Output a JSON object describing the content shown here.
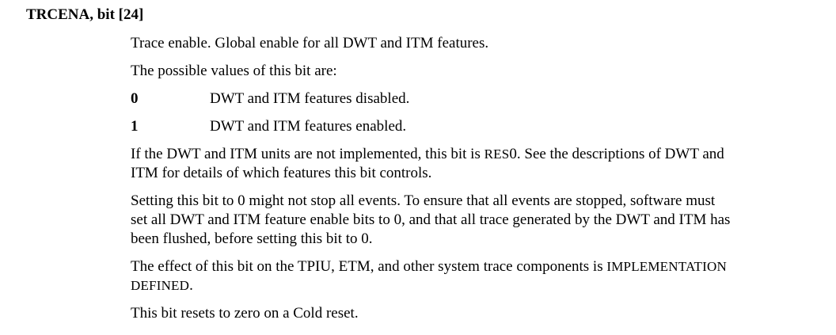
{
  "heading": "TRCENA, bit [24]",
  "description": "Trace enable. Global enable for all DWT and ITM features.",
  "values_intro": "The possible values of this bit are:",
  "values": [
    {
      "key": "0",
      "desc": "DWT and ITM features disabled."
    },
    {
      "key": "1",
      "desc": "DWT and ITM features enabled."
    }
  ],
  "not_implemented": {
    "line1_before": "If the DWT and ITM units are not implemented, this bit is ",
    "line1_term": "RES",
    "line1_after": "0. See the descriptions of DWT and",
    "line2": "ITM for details of which features this bit controls."
  },
  "stop_events": {
    "line1": "Setting this bit to 0 might not stop all events. To ensure that all events are stopped, software must",
    "line2": "set all DWT and ITM feature enable bits to 0, and that all trace generated by the DWT and ITM has",
    "line3": "been flushed, before setting this bit to 0."
  },
  "effect": {
    "line1_before": "The effect of this bit on the TPIU, ETM, and other system trace components is ",
    "line1_term": "IMPLEMENTATION",
    "line2_term": "DEFINED",
    "line2_after": "."
  },
  "reset": "This bit resets to zero on a Cold reset."
}
